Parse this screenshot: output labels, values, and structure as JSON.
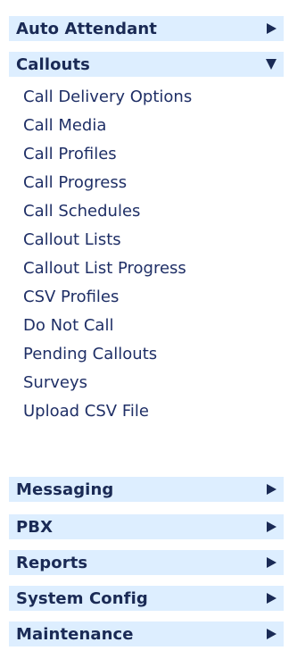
{
  "menu": {
    "sections": [
      {
        "label": "Auto Attendant",
        "arrow": "right-triangle-icon"
      },
      {
        "label": "Callouts",
        "arrow": "down-triangle-icon",
        "expanded": true
      },
      {
        "label": "Messaging",
        "arrow": "right-triangle-icon"
      },
      {
        "label": "PBX",
        "arrow": "right-triangle-icon"
      },
      {
        "label": "Reports",
        "arrow": "right-triangle-icon"
      },
      {
        "label": "System Config",
        "arrow": "right-triangle-icon"
      },
      {
        "label": "Maintenance",
        "arrow": "right-triangle-icon"
      }
    ],
    "callouts_items": [
      "Call Delivery Options",
      "Call Media",
      "Call Profiles",
      "Call Progress",
      "Call Schedules",
      "Callout Lists",
      "Callout List Progress",
      "CSV Profiles",
      "Do Not Call",
      "Pending Callouts",
      "Surveys",
      "Upload CSV File"
    ]
  },
  "colors": {
    "header_bg": "#ddeeff",
    "text": "#1f2f66",
    "arrow": "#1a2a55"
  }
}
